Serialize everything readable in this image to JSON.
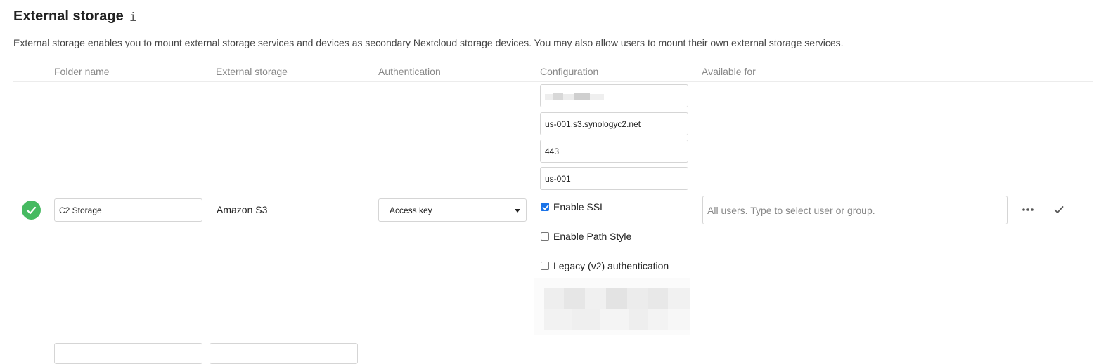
{
  "header": {
    "title": "External storage",
    "info_icon": "i",
    "description": "External storage enables you to mount external storage services and devices as secondary Nextcloud storage devices. You may also allow users to mount their own external storage services."
  },
  "columns": {
    "folder_name": "Folder name",
    "external_storage": "External storage",
    "authentication": "Authentication",
    "configuration": "Configuration",
    "available_for": "Available for"
  },
  "mount": {
    "status": "ok",
    "status_color": "#46ba61",
    "folder_name": "C2 Storage",
    "backend": "Amazon S3",
    "auth_method": "Access key",
    "config": {
      "hostname": "us-001.s3.synologyc2.net",
      "port": "443",
      "region": "us-001",
      "enable_ssl": {
        "label": "Enable SSL",
        "checked": true
      },
      "enable_path_style": {
        "label": "Enable Path Style",
        "checked": false
      },
      "legacy_auth": {
        "label": "Legacy (v2) authentication",
        "checked": false
      }
    },
    "available_for_placeholder": "All users. Type to select user or group.",
    "more_icon": "···",
    "save_icon": "check-icon"
  },
  "colors": {
    "accent": "#1a73e8",
    "success": "#46ba61"
  }
}
